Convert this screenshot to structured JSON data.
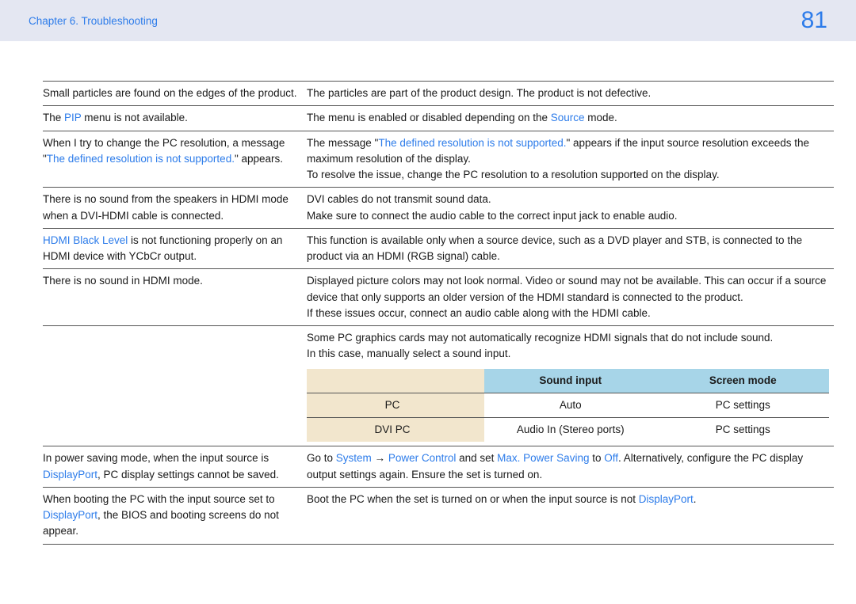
{
  "header": {
    "chapter_title": "Chapter 6. Troubleshooting",
    "page_number": "81"
  },
  "rows": {
    "r1": {
      "left": "Small particles are found on the edges of the product.",
      "right": "The particles are part of the product design. The product is not defective."
    },
    "r2": {
      "left_pre": "The ",
      "left_blue": "PIP",
      "left_post": " menu is not available.",
      "right_pre": "The menu is enabled or disabled depending on the ",
      "right_blue": "Source",
      "right_post": " mode."
    },
    "r3": {
      "left_pre": "When I try to change the PC resolution, a message \"",
      "left_blue": "The defined resolution is not supported.",
      "left_post": "\" appears.",
      "right_pre": "The message \"",
      "right_blue": "The defined resolution is not supported.",
      "right_post": "\" appears if the input source resolution exceeds the maximum resolution of the display.",
      "right_line2": "To resolve the issue, change the PC resolution to a resolution supported on the display."
    },
    "r4": {
      "left": "There is no sound from the speakers in HDMI mode when a DVI-HDMI cable is connected.",
      "right_line1": "DVI cables do not transmit sound data.",
      "right_line2": "Make sure to connect the audio cable to the correct input jack to enable audio."
    },
    "r5": {
      "left_blue": "HDMI Black Level",
      "left_post": " is not functioning properly on an HDMI device with YCbCr output.",
      "right": "This function is available only when a source device, such as a DVD player and STB, is connected to the product via an HDMI (RGB signal) cable."
    },
    "r6": {
      "left": "There is no sound in HDMI mode.",
      "right_p1": "Displayed picture colors may not look normal. Video or sound may not be available. This can occur if a source device that only supports an older version of the HDMI standard is connected to the product.",
      "right_p2": "If these issues occur, connect an audio cable along with the HDMI cable.",
      "right_p3": "Some PC graphics cards may not automatically recognize HDMI signals that do not include sound.",
      "right_p4": "In this case, manually select a sound input."
    },
    "inner": {
      "head_left": "",
      "head_c2": "Sound input",
      "head_c3": "Screen mode",
      "row1_c1": "PC",
      "row1_c2": "Auto",
      "row1_c3": "PC settings",
      "row2_c1": "DVI PC",
      "row2_c2": "Audio In (Stereo ports)",
      "row2_c3": "PC settings"
    },
    "r7": {
      "left_pre": "In power saving mode, when the input source is ",
      "left_blue": "DisplayPort",
      "left_post": ", PC display settings cannot be saved.",
      "right_pre": "Go to ",
      "right_b1": "System",
      "right_arrow": " → ",
      "right_b2": "Power Control",
      "right_mid1": " and set ",
      "right_b3": "Max. Power Saving",
      "right_mid2": " to ",
      "right_b4": "Off",
      "right_post": ". Alternatively, configure the PC display output settings again. Ensure the set is turned on."
    },
    "r8": {
      "left_pre": "When booting the PC with the input source set to ",
      "left_blue": "DisplayPort",
      "left_post": ", the BIOS and booting screens do not appear.",
      "right_pre": "Boot the PC when the set is turned on or when the input source is not ",
      "right_blue": "DisplayPort",
      "right_post": "."
    }
  }
}
